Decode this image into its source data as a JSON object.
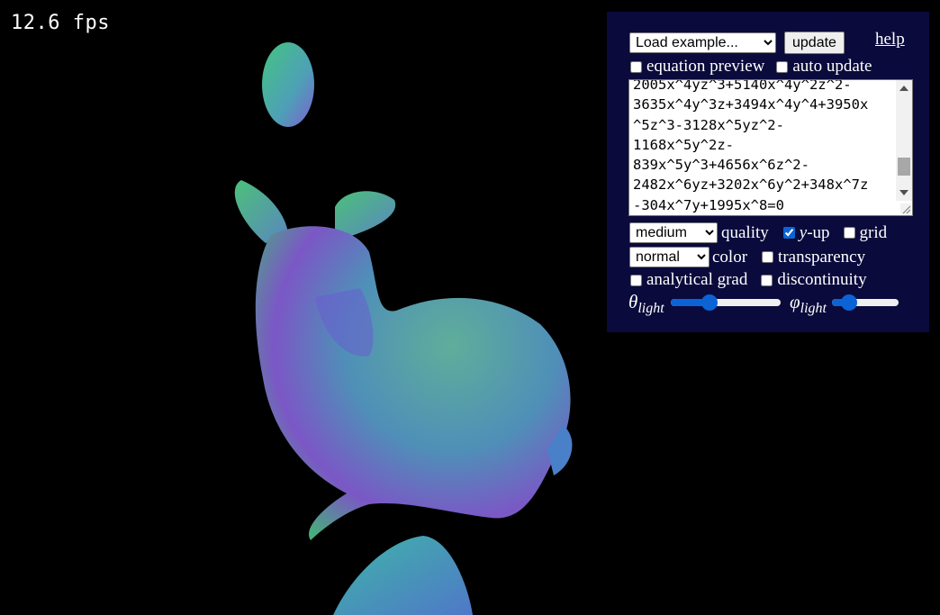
{
  "fps": "12.6 fps",
  "panel": {
    "example_select": "Load example...",
    "update_label": "update",
    "help_label": "help",
    "equation_preview_label": "equation preview",
    "auto_update_label": "auto update",
    "equation_lines": [
      "2005x^4yz^3+5140x^4y^2z^2-",
      "3635x^4y^3z+3494x^4y^4+3950x",
      "^5z^3-3128x^5yz^2-",
      "1168x^5y^2z-",
      "839x^5y^3+4656x^6z^2-",
      "2482x^6yz+3202x^6y^2+348x^7z",
      "-304x^7y+1995x^8=0"
    ],
    "quality_select": "medium",
    "quality_label": "quality",
    "yup_y": "y",
    "yup_suffix": "-up",
    "grid_label": "grid",
    "color_select": "normal",
    "color_label": "color",
    "transparency_label": "transparency",
    "analytical_grad_label": "analytical grad",
    "discontinuity_label": "discontinuity",
    "theta_symbol": "θ",
    "phi_symbol": "φ",
    "light_sub": "light",
    "theta_value": 0.35,
    "phi_value": 0.25,
    "checkboxes": {
      "equation_preview": false,
      "auto_update": false,
      "y_up": true,
      "grid": false,
      "transparency": false,
      "analytical_grad": false,
      "discontinuity": false
    }
  },
  "colors": {
    "panel_bg": "#0a0a3c",
    "accent": "#0b63d6"
  }
}
